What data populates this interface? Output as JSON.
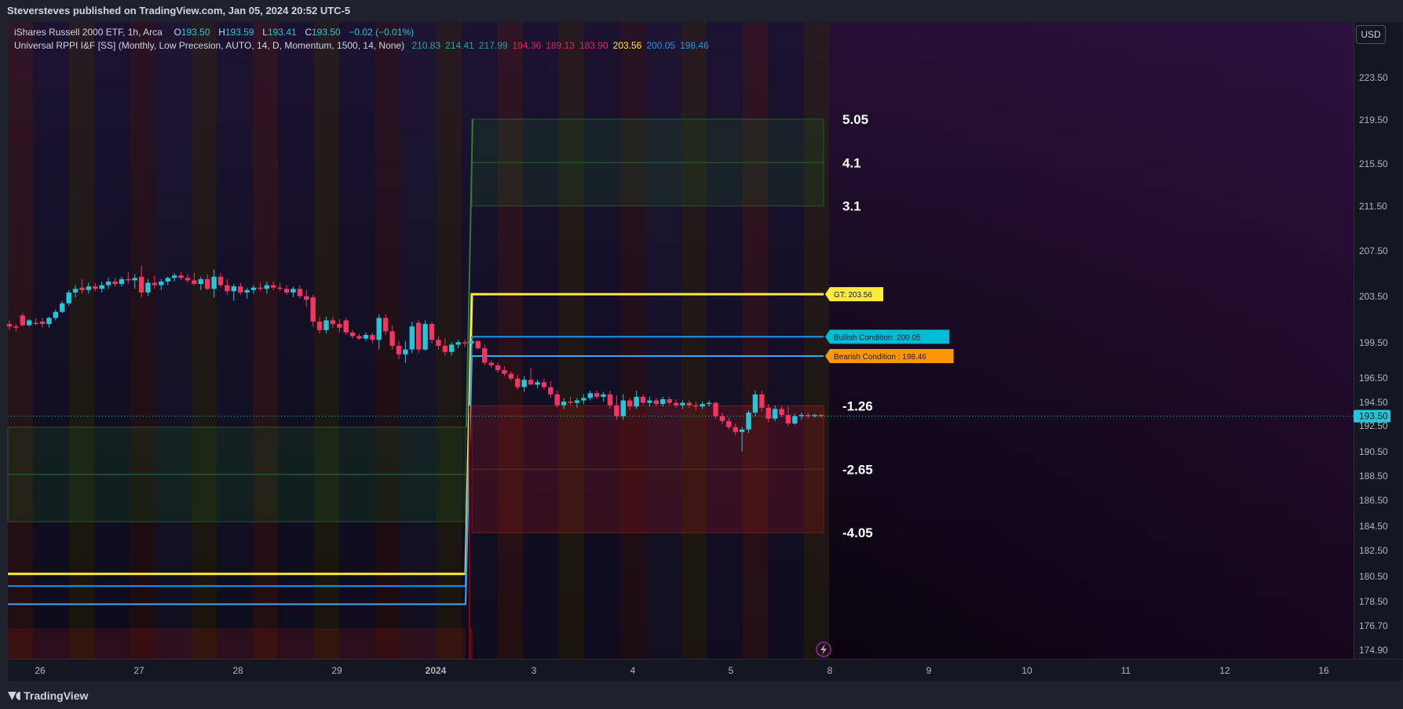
{
  "header": {
    "published": "Steversteves published on TradingView.com, Jan 05, 2024 20:52 UTC-5"
  },
  "legend": {
    "symbol": "iShares Russell 2000 ETF, 1h, Arca",
    "o_label": "O",
    "o_value": "193.50",
    "h_label": "H",
    "h_value": "193.59",
    "l_label": "L",
    "l_value": "193.41",
    "c_label": "C",
    "c_value": "193.50",
    "change": "−0.02 (−0.01%)",
    "indicator": "Universal RPPI I&F [SS] (Monthly, Low Precesion, AUTO, 14, D, Momentum, 1500, 14, None)",
    "indicator_values": [
      {
        "text": "210.83",
        "color": "#26a69a"
      },
      {
        "text": "214.41",
        "color": "#26a69a"
      },
      {
        "text": "217.99",
        "color": "#26a69a"
      },
      {
        "text": "194.36",
        "color": "#e0245e"
      },
      {
        "text": "189.13",
        "color": "#e0245e"
      },
      {
        "text": "183.90",
        "color": "#e0245e"
      },
      {
        "text": "203.56",
        "color": "#ffeb3b"
      },
      {
        "text": "200.05",
        "color": "#2196f3"
      },
      {
        "text": "198.46",
        "color": "#2196f3"
      }
    ]
  },
  "toolbar": {
    "currency": "USD"
  },
  "footer": {
    "brand": "TradingView"
  },
  "colors": {
    "up": "#26c6da",
    "down": "#f23661",
    "yellow": "#ffeb3b",
    "blue": "#2196f3",
    "bg": "#131722"
  },
  "chart_data": {
    "type": "candlestick",
    "symbol": "IWM",
    "timeframe": "1h",
    "y_axis": {
      "ticks": [
        "223.50",
        "219.50",
        "215.50",
        "211.50",
        "207.50",
        "203.50",
        "199.50",
        "196.50",
        "194.50",
        "192.50",
        "190.50",
        "188.50",
        "186.50",
        "184.50",
        "182.50",
        "180.50",
        "178.50",
        "176.70",
        "174.90"
      ],
      "range": [
        173.5,
        226
      ]
    },
    "x_axis": {
      "ticks": [
        "26",
        "27",
        "28",
        "29",
        "2024",
        "3",
        "4",
        "5",
        "8",
        "9",
        "10",
        "11",
        "12",
        "16"
      ]
    },
    "last_price": "193.50",
    "zone_labels": [
      "5.05",
      "4.1",
      "3.1",
      "-1.26",
      "-2.65",
      "-4.05"
    ],
    "upper_zones": [
      210.83,
      214.41,
      217.99
    ],
    "lower_zones": [
      194.36,
      189.13,
      183.9
    ],
    "previous_levels": {
      "gt": 180.5,
      "bullish": 179.5,
      "bearish": 178.0,
      "upper_zone_bounds": [
        192.6,
        188.7,
        184.8
      ],
      "lower_zone_bounds": [
        176.0
      ]
    },
    "level_labels": [
      {
        "text": "GT: 203.56",
        "value": 203.56,
        "color": "#ffeb3b",
        "text_color": "#131722"
      },
      {
        "text": "Bullish Condition: 200.05",
        "value": 200.05,
        "color": "#00bcd4",
        "text_color": "#131722"
      },
      {
        "text": "Bearish Condition : 198.46",
        "value": 198.46,
        "color": "#ff9800",
        "text_color": "#131722"
      }
    ],
    "candles": [
      {
        "o": 201.1,
        "h": 201.4,
        "l": 200.6,
        "c": 200.9
      },
      {
        "o": 200.9,
        "h": 201.1,
        "l": 200.5,
        "c": 200.8
      },
      {
        "o": 201.8,
        "h": 202.0,
        "l": 200.9,
        "c": 201.0
      },
      {
        "o": 201.0,
        "h": 201.5,
        "l": 200.9,
        "c": 201.4
      },
      {
        "o": 201.2,
        "h": 201.6,
        "l": 201.0,
        "c": 201.1
      },
      {
        "o": 201.3,
        "h": 201.6,
        "l": 200.8,
        "c": 201.1
      },
      {
        "o": 201.1,
        "h": 201.7,
        "l": 200.8,
        "c": 201.6
      },
      {
        "o": 201.6,
        "h": 202.3,
        "l": 201.4,
        "c": 202.1
      },
      {
        "o": 202.1,
        "h": 203.0,
        "l": 202.0,
        "c": 202.8
      },
      {
        "o": 202.8,
        "h": 203.9,
        "l": 202.6,
        "c": 203.7
      },
      {
        "o": 203.7,
        "h": 204.3,
        "l": 203.3,
        "c": 204.0
      },
      {
        "o": 204.1,
        "h": 204.8,
        "l": 203.6,
        "c": 203.9
      },
      {
        "o": 203.9,
        "h": 204.5,
        "l": 203.6,
        "c": 204.2
      },
      {
        "o": 204.2,
        "h": 204.5,
        "l": 203.8,
        "c": 204.0
      },
      {
        "o": 204.0,
        "h": 204.6,
        "l": 203.7,
        "c": 204.3
      },
      {
        "o": 204.3,
        "h": 204.9,
        "l": 204.0,
        "c": 204.6
      },
      {
        "o": 204.6,
        "h": 204.9,
        "l": 204.2,
        "c": 204.4
      },
      {
        "o": 204.4,
        "h": 205.0,
        "l": 204.2,
        "c": 204.8
      },
      {
        "o": 204.8,
        "h": 205.4,
        "l": 204.4,
        "c": 204.7
      },
      {
        "o": 204.7,
        "h": 205.2,
        "l": 204.0,
        "c": 204.9
      },
      {
        "o": 205.0,
        "h": 205.9,
        "l": 203.3,
        "c": 203.7
      },
      {
        "o": 203.7,
        "h": 204.8,
        "l": 203.4,
        "c": 204.5
      },
      {
        "o": 204.5,
        "h": 205.1,
        "l": 204.0,
        "c": 204.3
      },
      {
        "o": 204.3,
        "h": 204.8,
        "l": 203.9,
        "c": 204.6
      },
      {
        "o": 204.6,
        "h": 205.0,
        "l": 204.3,
        "c": 204.9
      },
      {
        "o": 204.9,
        "h": 205.3,
        "l": 204.6,
        "c": 205.1
      },
      {
        "o": 205.1,
        "h": 205.4,
        "l": 204.7,
        "c": 204.9
      },
      {
        "o": 204.9,
        "h": 205.2,
        "l": 204.5,
        "c": 204.7
      },
      {
        "o": 204.7,
        "h": 205.3,
        "l": 204.3,
        "c": 204.4
      },
      {
        "o": 204.4,
        "h": 205.0,
        "l": 203.9,
        "c": 204.8
      },
      {
        "o": 204.8,
        "h": 205.2,
        "l": 203.9,
        "c": 204.0
      },
      {
        "o": 204.0,
        "h": 205.6,
        "l": 203.3,
        "c": 205.0
      },
      {
        "o": 205.0,
        "h": 205.3,
        "l": 204.1,
        "c": 204.3
      },
      {
        "o": 204.3,
        "h": 204.8,
        "l": 203.5,
        "c": 203.8
      },
      {
        "o": 203.8,
        "h": 204.4,
        "l": 203.0,
        "c": 204.2
      },
      {
        "o": 204.2,
        "h": 204.5,
        "l": 203.5,
        "c": 203.7
      },
      {
        "o": 203.7,
        "h": 204.1,
        "l": 203.2,
        "c": 203.9
      },
      {
        "o": 203.9,
        "h": 204.3,
        "l": 203.6,
        "c": 204.1
      },
      {
        "o": 204.1,
        "h": 204.5,
        "l": 203.8,
        "c": 204.0
      },
      {
        "o": 204.0,
        "h": 204.6,
        "l": 203.6,
        "c": 204.3
      },
      {
        "o": 204.3,
        "h": 204.6,
        "l": 203.9,
        "c": 204.1
      },
      {
        "o": 204.1,
        "h": 204.5,
        "l": 203.8,
        "c": 204.0
      },
      {
        "o": 204.0,
        "h": 204.3,
        "l": 203.5,
        "c": 203.7
      },
      {
        "o": 203.7,
        "h": 204.2,
        "l": 203.3,
        "c": 204.0
      },
      {
        "o": 204.0,
        "h": 204.3,
        "l": 203.2,
        "c": 203.4
      },
      {
        "o": 203.4,
        "h": 203.9,
        "l": 202.5,
        "c": 203.1
      },
      {
        "o": 203.3,
        "h": 203.5,
        "l": 200.9,
        "c": 201.3
      },
      {
        "o": 201.3,
        "h": 201.7,
        "l": 200.3,
        "c": 200.6
      },
      {
        "o": 200.6,
        "h": 201.7,
        "l": 200.3,
        "c": 201.4
      },
      {
        "o": 201.4,
        "h": 201.7,
        "l": 200.8,
        "c": 201.1
      },
      {
        "o": 201.1,
        "h": 201.5,
        "l": 200.4,
        "c": 200.8
      },
      {
        "o": 201.4,
        "h": 201.6,
        "l": 200.2,
        "c": 200.4
      },
      {
        "o": 200.4,
        "h": 200.6,
        "l": 199.9,
        "c": 200.1
      },
      {
        "o": 200.1,
        "h": 200.3,
        "l": 199.8,
        "c": 199.9
      },
      {
        "o": 199.9,
        "h": 200.4,
        "l": 199.7,
        "c": 200.2
      },
      {
        "o": 200.2,
        "h": 200.4,
        "l": 199.5,
        "c": 199.8
      },
      {
        "o": 199.8,
        "h": 201.9,
        "l": 199.0,
        "c": 201.6
      },
      {
        "o": 201.6,
        "h": 201.9,
        "l": 200.2,
        "c": 200.5
      },
      {
        "o": 200.5,
        "h": 201.0,
        "l": 199.0,
        "c": 199.3
      },
      {
        "o": 199.3,
        "h": 199.7,
        "l": 198.2,
        "c": 198.6
      },
      {
        "o": 198.6,
        "h": 199.7,
        "l": 197.9,
        "c": 199.0
      },
      {
        "o": 199.0,
        "h": 201.3,
        "l": 198.7,
        "c": 200.9
      },
      {
        "o": 201.2,
        "h": 201.4,
        "l": 198.7,
        "c": 199.0
      },
      {
        "o": 199.0,
        "h": 201.4,
        "l": 198.9,
        "c": 201.1
      },
      {
        "o": 201.1,
        "h": 201.3,
        "l": 199.5,
        "c": 199.8
      },
      {
        "o": 199.8,
        "h": 200.1,
        "l": 199.0,
        "c": 199.3
      },
      {
        "o": 199.3,
        "h": 199.9,
        "l": 198.5,
        "c": 198.8
      },
      {
        "o": 198.8,
        "h": 199.6,
        "l": 198.5,
        "c": 199.4
      },
      {
        "o": 199.4,
        "h": 199.8,
        "l": 199.1,
        "c": 199.6
      },
      {
        "o": 199.6,
        "h": 199.8,
        "l": 199.2,
        "c": 199.5
      },
      {
        "o": 199.5,
        "h": 199.9,
        "l": 199.3,
        "c": 199.7
      },
      {
        "o": 199.7,
        "h": 199.8,
        "l": 199.0,
        "c": 199.1
      },
      {
        "o": 199.1,
        "h": 199.4,
        "l": 197.7,
        "c": 197.9
      },
      {
        "o": 197.9,
        "h": 198.1,
        "l": 197.5,
        "c": 197.7
      },
      {
        "o": 197.7,
        "h": 197.9,
        "l": 197.1,
        "c": 197.3
      },
      {
        "o": 197.3,
        "h": 197.6,
        "l": 196.8,
        "c": 197.0
      },
      {
        "o": 197.0,
        "h": 197.2,
        "l": 196.4,
        "c": 196.6
      },
      {
        "o": 196.6,
        "h": 196.9,
        "l": 195.7,
        "c": 195.9
      },
      {
        "o": 195.9,
        "h": 196.8,
        "l": 195.5,
        "c": 196.5
      },
      {
        "o": 196.5,
        "h": 197.5,
        "l": 196.3,
        "c": 196.1
      },
      {
        "o": 196.1,
        "h": 196.5,
        "l": 195.8,
        "c": 196.3
      },
      {
        "o": 196.3,
        "h": 196.6,
        "l": 195.7,
        "c": 195.9
      },
      {
        "o": 195.9,
        "h": 196.4,
        "l": 195.0,
        "c": 195.3
      },
      {
        "o": 195.3,
        "h": 195.6,
        "l": 194.2,
        "c": 194.4
      },
      {
        "o": 194.4,
        "h": 195.0,
        "l": 194.1,
        "c": 194.7
      },
      {
        "o": 194.7,
        "h": 195.1,
        "l": 194.4,
        "c": 194.6
      },
      {
        "o": 194.6,
        "h": 195.0,
        "l": 194.2,
        "c": 194.8
      },
      {
        "o": 194.8,
        "h": 195.3,
        "l": 194.5,
        "c": 195.0
      },
      {
        "o": 195.0,
        "h": 195.6,
        "l": 194.8,
        "c": 195.4
      },
      {
        "o": 195.4,
        "h": 195.6,
        "l": 194.9,
        "c": 195.1
      },
      {
        "o": 195.1,
        "h": 195.5,
        "l": 194.7,
        "c": 195.3
      },
      {
        "o": 195.3,
        "h": 195.6,
        "l": 194.1,
        "c": 194.4
      },
      {
        "o": 194.4,
        "h": 195.2,
        "l": 193.2,
        "c": 193.5
      },
      {
        "o": 193.5,
        "h": 195.3,
        "l": 193.2,
        "c": 194.8
      },
      {
        "o": 194.8,
        "h": 195.0,
        "l": 194.0,
        "c": 194.3
      },
      {
        "o": 194.3,
        "h": 195.6,
        "l": 194.1,
        "c": 195.1
      },
      {
        "o": 195.1,
        "h": 195.3,
        "l": 194.4,
        "c": 194.6
      },
      {
        "o": 194.6,
        "h": 195.1,
        "l": 194.3,
        "c": 194.8
      },
      {
        "o": 194.8,
        "h": 195.0,
        "l": 194.3,
        "c": 194.5
      },
      {
        "o": 194.5,
        "h": 195.1,
        "l": 194.3,
        "c": 194.9
      },
      {
        "o": 194.9,
        "h": 195.1,
        "l": 194.4,
        "c": 194.6
      },
      {
        "o": 194.6,
        "h": 194.9,
        "l": 194.2,
        "c": 194.4
      },
      {
        "o": 194.4,
        "h": 194.8,
        "l": 194.1,
        "c": 194.6
      },
      {
        "o": 194.6,
        "h": 194.8,
        "l": 194.2,
        "c": 194.4
      },
      {
        "o": 194.4,
        "h": 194.7,
        "l": 194.0,
        "c": 194.3
      },
      {
        "o": 194.3,
        "h": 194.7,
        "l": 194.1,
        "c": 194.5
      },
      {
        "o": 194.5,
        "h": 194.8,
        "l": 194.3,
        "c": 194.6
      },
      {
        "o": 194.6,
        "h": 194.7,
        "l": 193.3,
        "c": 193.5
      },
      {
        "o": 193.5,
        "h": 193.8,
        "l": 192.9,
        "c": 193.1
      },
      {
        "o": 193.1,
        "h": 193.4,
        "l": 192.4,
        "c": 192.6
      },
      {
        "o": 192.6,
        "h": 192.9,
        "l": 191.9,
        "c": 192.2
      },
      {
        "o": 192.2,
        "h": 192.6,
        "l": 190.6,
        "c": 192.4
      },
      {
        "o": 192.4,
        "h": 194.0,
        "l": 192.1,
        "c": 193.8
      },
      {
        "o": 193.8,
        "h": 195.6,
        "l": 193.5,
        "c": 195.3
      },
      {
        "o": 195.3,
        "h": 195.6,
        "l": 193.9,
        "c": 194.2
      },
      {
        "o": 194.2,
        "h": 194.5,
        "l": 193.0,
        "c": 193.3
      },
      {
        "o": 193.3,
        "h": 194.4,
        "l": 193.1,
        "c": 194.1
      },
      {
        "o": 194.1,
        "h": 194.3,
        "l": 193.4,
        "c": 193.6
      },
      {
        "o": 193.6,
        "h": 194.3,
        "l": 192.7,
        "c": 192.9
      },
      {
        "o": 192.9,
        "h": 193.7,
        "l": 192.8,
        "c": 193.5
      },
      {
        "o": 193.5,
        "h": 193.8,
        "l": 193.2,
        "c": 193.6
      },
      {
        "o": 193.6,
        "h": 193.8,
        "l": 193.3,
        "c": 193.5
      },
      {
        "o": 193.5,
        "h": 193.7,
        "l": 193.4,
        "c": 193.6
      },
      {
        "o": 193.6,
        "h": 193.7,
        "l": 193.4,
        "c": 193.5
      }
    ]
  }
}
